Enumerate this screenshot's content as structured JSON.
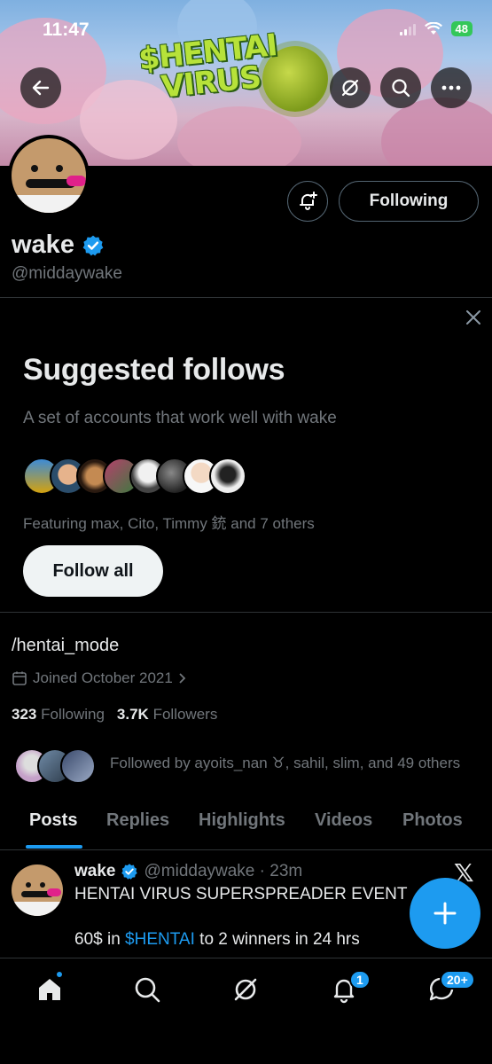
{
  "status_bar": {
    "time": "11:47",
    "battery": "48"
  },
  "banner": {
    "title_line1": "$HENTAI",
    "title_line2": "VIRUS"
  },
  "profile": {
    "display_name": "wake",
    "handle": "@middaywake",
    "following_button": "Following",
    "bio": "/hentai_mode",
    "joined": "Joined October 2021",
    "following_count": "323",
    "following_label": "Following",
    "followers_count": "3.7K",
    "followers_label": "Followers",
    "followed_by": "Followed by ayoits_nan ♉, sahil, slim, and 49 others"
  },
  "suggested": {
    "title": "Suggested follows",
    "subtitle": "A set of accounts that work well with wake",
    "featuring": "Featuring max, Cito, Timmy 銃 and 7 others",
    "follow_all": "Follow all"
  },
  "tabs": [
    {
      "label": "Posts"
    },
    {
      "label": "Replies"
    },
    {
      "label": "Highlights"
    },
    {
      "label": "Videos"
    },
    {
      "label": "Photos"
    }
  ],
  "post": {
    "name": "wake",
    "meta": "@middaywake · 23m",
    "line1": "HENTAI VIRUS SUPERSPREADER EVENT",
    "line2_pre": "60$ in ",
    "line2_link": "$HENTAI",
    "line2_post": " to 2 winners in 24 hrs"
  },
  "nav": {
    "notifications_badge": "1",
    "messages_badge": "20+"
  },
  "colors": {
    "accent": "#1d9bf0",
    "muted": "#71767b",
    "text": "#e7e9ea",
    "background": "#000000"
  }
}
